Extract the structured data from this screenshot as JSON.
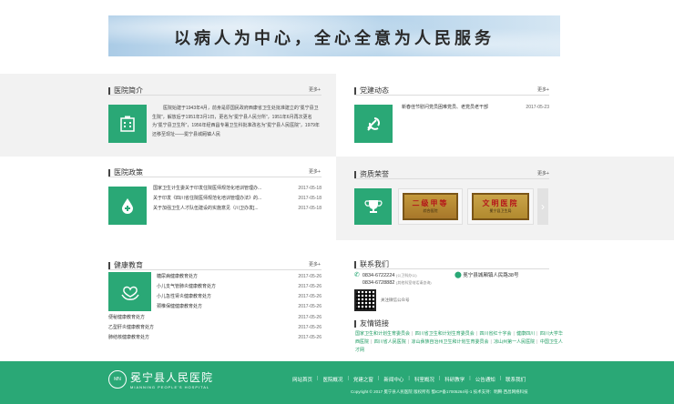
{
  "banner": {
    "slogan": "以病人为中心，全心全意为人民服务"
  },
  "intro": {
    "title": "医院简介",
    "more": "更多+",
    "text": "医院始建于1943年4月，前身是原国民政府西康省卫生处批准建立的“冕宁县卫生院”，解放后于1951年3月1日，更名为“冕宁县人民分所”，1951年6月再次更名为“冕宁县卫生所”，1956年经西昌专署卫生科批准改名为“冕宁县人民医院”，1979年还移至现址——冕宁县城厢镇人民"
  },
  "party": {
    "title": "党建动态",
    "more": "更多+",
    "items": [
      {
        "text": "新春佳节慰问党员困难党员、老党员老干部",
        "date": "2017-05-23"
      }
    ]
  },
  "policy": {
    "title": "医院政策",
    "more": "更多+",
    "items": [
      {
        "text": "国家卫生计生委关于印发住院医师规范化培训管理办...",
        "date": "2017-05-18"
      },
      {
        "text": "关于印发《四川省住院医师规范化培训管理办法》的...",
        "date": "2017-05-18"
      },
      {
        "text": "关于加强卫生人才队伍建设的实施意见（川卫办发[...",
        "date": "2017-05-18"
      }
    ]
  },
  "honors": {
    "title": "资质荣誉",
    "more": "更多+",
    "plaque1": {
      "title": "二级甲等",
      "sub": "综合医院"
    },
    "plaque2": {
      "title": "文明医院",
      "sub": "冕宁县卫生局"
    },
    "arrow": "›"
  },
  "health": {
    "title": "健康教育",
    "more": "更多+",
    "items_with_icon": [
      {
        "text": "糖尿病健康教育处方",
        "date": "2017-05-26"
      },
      {
        "text": "小儿支气管肺炎健康教育处方",
        "date": "2017-05-26"
      },
      {
        "text": "小儿急性肾炎健康教育处方",
        "date": "2017-05-26"
      },
      {
        "text": "颈椎保健健康教育处方",
        "date": "2017-05-26"
      }
    ],
    "items_full": [
      {
        "text": "便秘健康教育处方",
        "date": "2017-05-26"
      },
      {
        "text": "乙型肝炎健康教育处方",
        "date": "2017-05-26"
      },
      {
        "text": "肺结核健康教育处方",
        "date": "2017-05-26"
      }
    ]
  },
  "contact": {
    "title": "联系我们",
    "phone1": "0834-6722224",
    "phone1_note": "(公卫科办公)",
    "phone2": "0834-6728882",
    "phone2_note": "(其他科室电话请咨询)",
    "address": "冕宁县城厢镇人民路38号",
    "qr_note": "关注微信公众号"
  },
  "links": {
    "title": "友情链接",
    "items": [
      "国家卫生和计划生育委员会",
      "四川省卫生和计划生育委员会",
      "四川省红十字会",
      "健康四川",
      "四川大学华西医院",
      "四川省人民医院",
      "凉山彝族自治州卫生和计划生育委员会",
      "凉山州第一人民医院",
      "中国卫生人才网"
    ]
  },
  "footer": {
    "logo_text": "冕宁县人民医院",
    "logo_en": "MIANNING PEOPLE'S HOSPITAL",
    "logo_mark": "MN",
    "nav": [
      "网站首页",
      "医院概况",
      "党建之窗",
      "新闻中心",
      "科室概况",
      "科研教学",
      "公告通知",
      "联系我们"
    ],
    "copyright": "Copyright © 2017 冕宁县人民医院 版权所有 蜀ICP备17005264号-1 技术支持：明腾·西昌网络科技"
  },
  "colors": {
    "brand_green": "#2aa876",
    "link_green": "#1e9c62",
    "band_gray": "#f2f2f2"
  }
}
